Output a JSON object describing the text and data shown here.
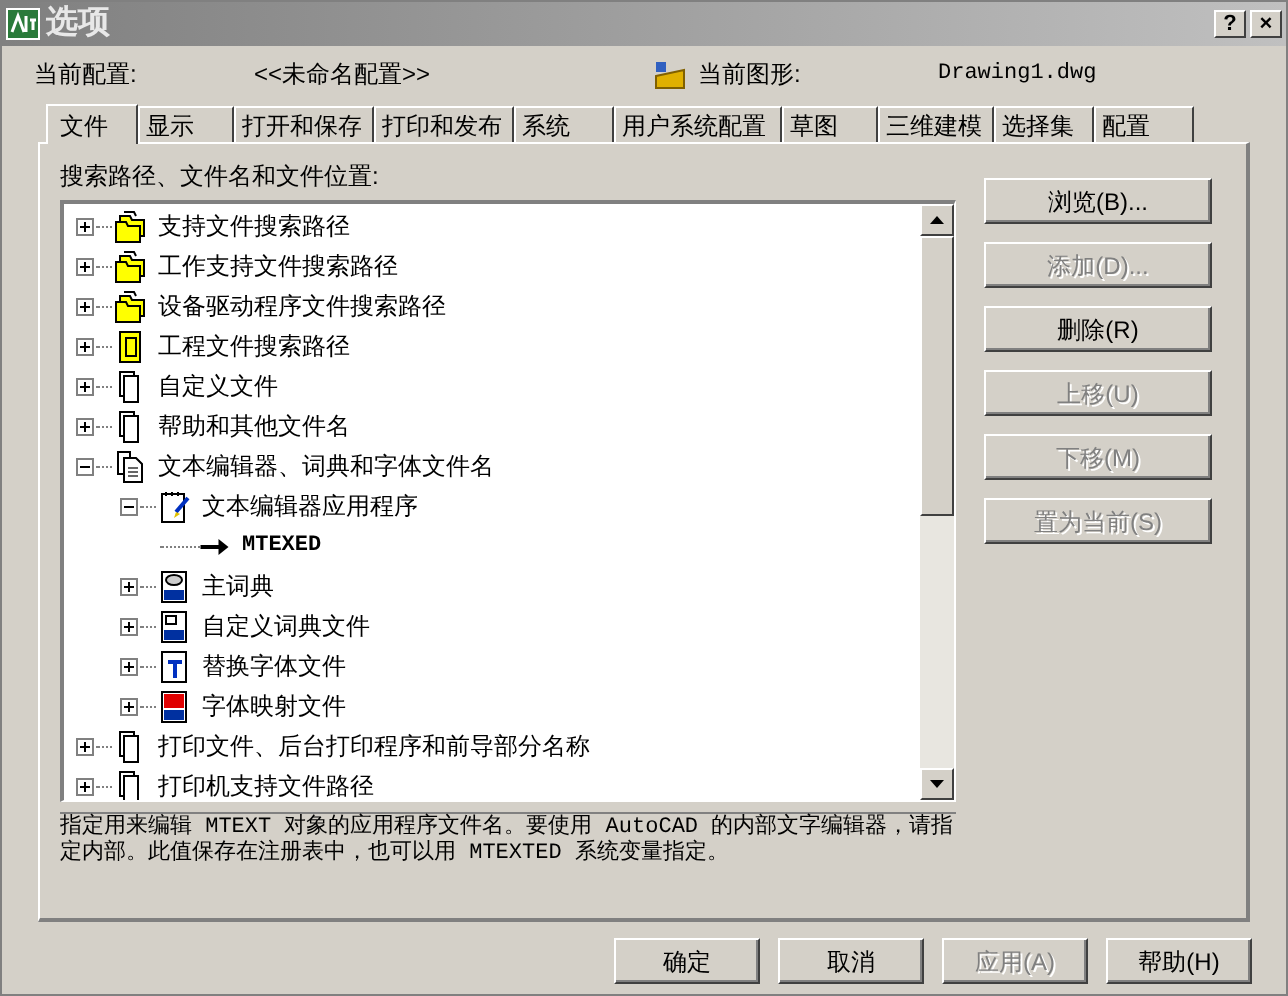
{
  "window": {
    "title": "选项"
  },
  "title_buttons": [
    "?",
    "×"
  ],
  "header": {
    "profile_label": "当前配置:",
    "profile_value": "<<未命名配置>>",
    "drawing_label": "当前图形:",
    "drawing_value": "Drawing1.dwg"
  },
  "tabs": [
    {
      "label": "文件",
      "selected": true
    },
    {
      "label": "显示",
      "selected": false
    },
    {
      "label": "打开和保存",
      "selected": false
    },
    {
      "label": "打印和发布",
      "selected": false
    },
    {
      "label": "系统",
      "selected": false
    },
    {
      "label": "用户系统配置",
      "selected": false
    },
    {
      "label": "草图",
      "selected": false
    },
    {
      "label": "三维建模",
      "selected": false
    },
    {
      "label": "选择集",
      "selected": false
    },
    {
      "label": "配置",
      "selected": false
    }
  ],
  "tree_label": "搜索路径、文件名和文件位置:",
  "tree": [
    {
      "label": "支持文件搜索路径",
      "kind": "folders",
      "expanded": false
    },
    {
      "label": "工作支持文件搜索路径",
      "kind": "folders",
      "expanded": false
    },
    {
      "label": "设备驱动程序文件搜索路径",
      "kind": "folders",
      "expanded": false
    },
    {
      "label": "工程文件搜索路径",
      "kind": "project",
      "expanded": false
    },
    {
      "label": "自定义文件",
      "kind": "files",
      "expanded": false
    },
    {
      "label": "帮助和其他文件名",
      "kind": "files",
      "expanded": false
    },
    {
      "label": "文本编辑器、词典和字体文件名",
      "kind": "docs",
      "expanded": true,
      "children": [
        {
          "label": "文本编辑器应用程序",
          "kind": "notepad",
          "expanded": true,
          "children": [
            {
              "label": "MTEXED",
              "kind": "arrow"
            }
          ]
        },
        {
          "label": "主词典",
          "kind": "dct",
          "expanded": false
        },
        {
          "label": "自定义词典文件",
          "kind": "cus",
          "expanded": false
        },
        {
          "label": "替换字体文件",
          "kind": "font",
          "expanded": false
        },
        {
          "label": "字体映射文件",
          "kind": "fmp",
          "expanded": false
        }
      ]
    },
    {
      "label": "打印文件、后台打印程序和前导部分名称",
      "kind": "files",
      "expanded": false
    },
    {
      "label": "打印机支持文件路径",
      "kind": "files",
      "expanded": false
    }
  ],
  "side_buttons": [
    {
      "label": "浏览(B)...",
      "disabled": false
    },
    {
      "label": "添加(D)...",
      "disabled": true
    },
    {
      "label": "删除(R)",
      "disabled": false
    },
    {
      "label": "上移(U)",
      "disabled": true
    },
    {
      "label": "下移(M)",
      "disabled": true
    },
    {
      "label": "置为当前(S)",
      "disabled": true
    }
  ],
  "description": "指定用来编辑 MTEXT 对象的应用程序文件名。要使用 AutoCAD 的内部文字编辑器，请指定内部。此值保存在注册表中，也可以用 MTEXTED 系统变量指定。",
  "footer_buttons": [
    {
      "label": "确定",
      "disabled": false
    },
    {
      "label": "取消",
      "disabled": false
    },
    {
      "label": "应用(A)",
      "disabled": true
    },
    {
      "label": "帮助(H)",
      "disabled": false
    }
  ]
}
